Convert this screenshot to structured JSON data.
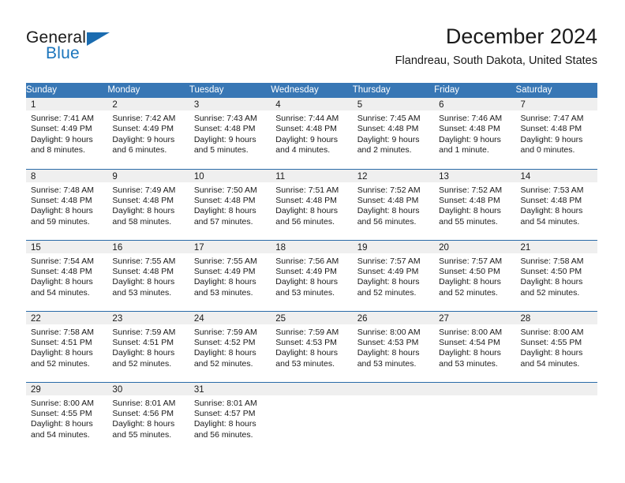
{
  "brand": {
    "name_part1": "General",
    "name_part2": "Blue",
    "flag_icon": "triangle-flag-icon"
  },
  "header": {
    "title": "December 2024",
    "subtitle": "Flandreau, South Dakota, United States"
  },
  "colors": {
    "header_row_bg": "#3877b5",
    "row_divider": "#2a6ba8",
    "daynum_bg": "#efefef",
    "brand_blue": "#1b75bc",
    "text": "#1a1a1a"
  },
  "calendar": {
    "weekday_headers": [
      "Sunday",
      "Monday",
      "Tuesday",
      "Wednesday",
      "Thursday",
      "Friday",
      "Saturday"
    ],
    "labels": {
      "sunrise": "Sunrise:",
      "sunset": "Sunset:",
      "daylight": "Daylight:"
    },
    "weeks": [
      [
        {
          "day": "1",
          "sunrise": "Sunrise: 7:41 AM",
          "sunset": "Sunset: 4:49 PM",
          "daylight": "Daylight: 9 hours and 8 minutes."
        },
        {
          "day": "2",
          "sunrise": "Sunrise: 7:42 AM",
          "sunset": "Sunset: 4:49 PM",
          "daylight": "Daylight: 9 hours and 6 minutes."
        },
        {
          "day": "3",
          "sunrise": "Sunrise: 7:43 AM",
          "sunset": "Sunset: 4:48 PM",
          "daylight": "Daylight: 9 hours and 5 minutes."
        },
        {
          "day": "4",
          "sunrise": "Sunrise: 7:44 AM",
          "sunset": "Sunset: 4:48 PM",
          "daylight": "Daylight: 9 hours and 4 minutes."
        },
        {
          "day": "5",
          "sunrise": "Sunrise: 7:45 AM",
          "sunset": "Sunset: 4:48 PM",
          "daylight": "Daylight: 9 hours and 2 minutes."
        },
        {
          "day": "6",
          "sunrise": "Sunrise: 7:46 AM",
          "sunset": "Sunset: 4:48 PM",
          "daylight": "Daylight: 9 hours and 1 minute."
        },
        {
          "day": "7",
          "sunrise": "Sunrise: 7:47 AM",
          "sunset": "Sunset: 4:48 PM",
          "daylight": "Daylight: 9 hours and 0 minutes."
        }
      ],
      [
        {
          "day": "8",
          "sunrise": "Sunrise: 7:48 AM",
          "sunset": "Sunset: 4:48 PM",
          "daylight": "Daylight: 8 hours and 59 minutes."
        },
        {
          "day": "9",
          "sunrise": "Sunrise: 7:49 AM",
          "sunset": "Sunset: 4:48 PM",
          "daylight": "Daylight: 8 hours and 58 minutes."
        },
        {
          "day": "10",
          "sunrise": "Sunrise: 7:50 AM",
          "sunset": "Sunset: 4:48 PM",
          "daylight": "Daylight: 8 hours and 57 minutes."
        },
        {
          "day": "11",
          "sunrise": "Sunrise: 7:51 AM",
          "sunset": "Sunset: 4:48 PM",
          "daylight": "Daylight: 8 hours and 56 minutes."
        },
        {
          "day": "12",
          "sunrise": "Sunrise: 7:52 AM",
          "sunset": "Sunset: 4:48 PM",
          "daylight": "Daylight: 8 hours and 56 minutes."
        },
        {
          "day": "13",
          "sunrise": "Sunrise: 7:52 AM",
          "sunset": "Sunset: 4:48 PM",
          "daylight": "Daylight: 8 hours and 55 minutes."
        },
        {
          "day": "14",
          "sunrise": "Sunrise: 7:53 AM",
          "sunset": "Sunset: 4:48 PM",
          "daylight": "Daylight: 8 hours and 54 minutes."
        }
      ],
      [
        {
          "day": "15",
          "sunrise": "Sunrise: 7:54 AM",
          "sunset": "Sunset: 4:48 PM",
          "daylight": "Daylight: 8 hours and 54 minutes."
        },
        {
          "day": "16",
          "sunrise": "Sunrise: 7:55 AM",
          "sunset": "Sunset: 4:48 PM",
          "daylight": "Daylight: 8 hours and 53 minutes."
        },
        {
          "day": "17",
          "sunrise": "Sunrise: 7:55 AM",
          "sunset": "Sunset: 4:49 PM",
          "daylight": "Daylight: 8 hours and 53 minutes."
        },
        {
          "day": "18",
          "sunrise": "Sunrise: 7:56 AM",
          "sunset": "Sunset: 4:49 PM",
          "daylight": "Daylight: 8 hours and 53 minutes."
        },
        {
          "day": "19",
          "sunrise": "Sunrise: 7:57 AM",
          "sunset": "Sunset: 4:49 PM",
          "daylight": "Daylight: 8 hours and 52 minutes."
        },
        {
          "day": "20",
          "sunrise": "Sunrise: 7:57 AM",
          "sunset": "Sunset: 4:50 PM",
          "daylight": "Daylight: 8 hours and 52 minutes."
        },
        {
          "day": "21",
          "sunrise": "Sunrise: 7:58 AM",
          "sunset": "Sunset: 4:50 PM",
          "daylight": "Daylight: 8 hours and 52 minutes."
        }
      ],
      [
        {
          "day": "22",
          "sunrise": "Sunrise: 7:58 AM",
          "sunset": "Sunset: 4:51 PM",
          "daylight": "Daylight: 8 hours and 52 minutes."
        },
        {
          "day": "23",
          "sunrise": "Sunrise: 7:59 AM",
          "sunset": "Sunset: 4:51 PM",
          "daylight": "Daylight: 8 hours and 52 minutes."
        },
        {
          "day": "24",
          "sunrise": "Sunrise: 7:59 AM",
          "sunset": "Sunset: 4:52 PM",
          "daylight": "Daylight: 8 hours and 52 minutes."
        },
        {
          "day": "25",
          "sunrise": "Sunrise: 7:59 AM",
          "sunset": "Sunset: 4:53 PM",
          "daylight": "Daylight: 8 hours and 53 minutes."
        },
        {
          "day": "26",
          "sunrise": "Sunrise: 8:00 AM",
          "sunset": "Sunset: 4:53 PM",
          "daylight": "Daylight: 8 hours and 53 minutes."
        },
        {
          "day": "27",
          "sunrise": "Sunrise: 8:00 AM",
          "sunset": "Sunset: 4:54 PM",
          "daylight": "Daylight: 8 hours and 53 minutes."
        },
        {
          "day": "28",
          "sunrise": "Sunrise: 8:00 AM",
          "sunset": "Sunset: 4:55 PM",
          "daylight": "Daylight: 8 hours and 54 minutes."
        }
      ],
      [
        {
          "day": "29",
          "sunrise": "Sunrise: 8:00 AM",
          "sunset": "Sunset: 4:55 PM",
          "daylight": "Daylight: 8 hours and 54 minutes."
        },
        {
          "day": "30",
          "sunrise": "Sunrise: 8:01 AM",
          "sunset": "Sunset: 4:56 PM",
          "daylight": "Daylight: 8 hours and 55 minutes."
        },
        {
          "day": "31",
          "sunrise": "Sunrise: 8:01 AM",
          "sunset": "Sunset: 4:57 PM",
          "daylight": "Daylight: 8 hours and 56 minutes."
        },
        {
          "day": "",
          "sunrise": "",
          "sunset": "",
          "daylight": ""
        },
        {
          "day": "",
          "sunrise": "",
          "sunset": "",
          "daylight": ""
        },
        {
          "day": "",
          "sunrise": "",
          "sunset": "",
          "daylight": ""
        },
        {
          "day": "",
          "sunrise": "",
          "sunset": "",
          "daylight": ""
        }
      ]
    ]
  }
}
